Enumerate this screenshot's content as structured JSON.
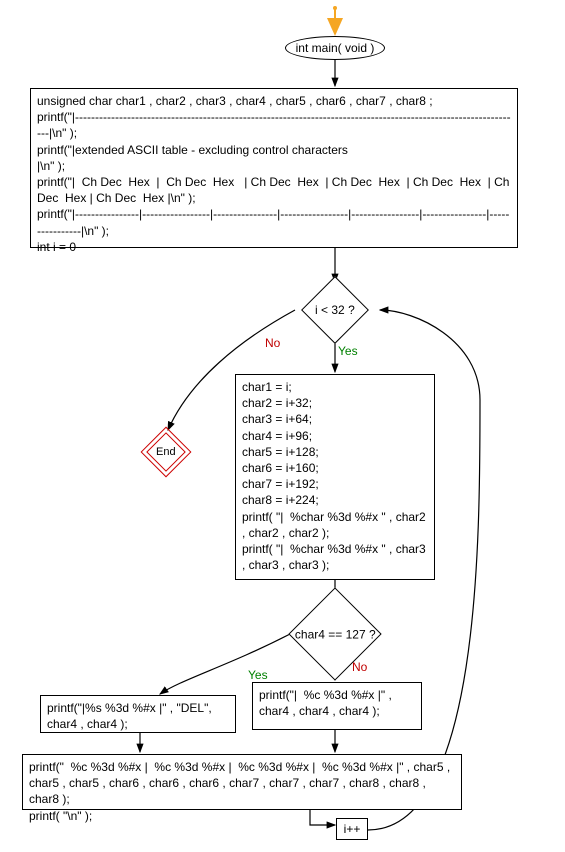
{
  "chart_data": {
    "type": "flowchart",
    "title": "",
    "nodes": [
      {
        "id": "start",
        "kind": "start-marker",
        "label": ""
      },
      {
        "id": "main",
        "kind": "terminator",
        "label": "int main( void )"
      },
      {
        "id": "init",
        "kind": "process",
        "label": "unsigned char char1 , char2 , char3 , char4 , char5 , char6 , char7 , char8 ;\nprintf(\"|----------------------------------------------------------------------------------------------------------------|\\n\" );\nprintf(\"|extended ASCII table - excluding control characters                                                 |\\n\" );\nprintf(\"|  Ch Dec  Hex  |  Ch Dec  Hex   | Ch Dec  Hex  | Ch Dec  Hex  | Ch Dec  Hex  | Ch Dec  Hex | Ch Dec  Hex |\\n\" );\nprintf(\"|----------------|-----------------|----------------|-----------------|-----------------|----------------|----------------|\\n\" );\nint i = 0"
      },
      {
        "id": "cond1",
        "kind": "decision",
        "label": "i < 32 ?"
      },
      {
        "id": "end",
        "kind": "end",
        "label": "End"
      },
      {
        "id": "assign",
        "kind": "process",
        "label": "char1 = i;\nchar2 = i+32;\nchar3 = i+64;\nchar4 = i+96;\nchar5 = i+128;\nchar6 = i+160;\nchar7 = i+192;\nchar8 = i+224;\nprintf( \"|  %char %3d %#x \" , char2 , char2 , char2 );\nprintf( \"|  %char %3d %#x \" , char3 , char3 , char3 );"
      },
      {
        "id": "cond2",
        "kind": "decision",
        "label": "char4 == 127 ?"
      },
      {
        "id": "yesbranch",
        "kind": "process",
        "label": "printf(\"|%s %3d %#x |\" , \"DEL\", char4 , char4 );"
      },
      {
        "id": "nobranch",
        "kind": "process",
        "label": "printf(\"|  %c %3d %#x |\" , char4 , char4 , char4 );"
      },
      {
        "id": "tail",
        "kind": "process",
        "label": "printf(\"  %c %3d %#x |  %c %3d %#x |  %c %3d %#x |  %c %3d %#x |\" , char5 , char5 , char5 , char6 , char6 , char6 , char7 , char7 , char7 , char8 , char8 , char8 );\nprintf( \"\\n\" );"
      },
      {
        "id": "inc",
        "kind": "process",
        "label": "i++"
      }
    ],
    "edges": [
      {
        "from": "start",
        "to": "main",
        "label": ""
      },
      {
        "from": "main",
        "to": "init",
        "label": ""
      },
      {
        "from": "init",
        "to": "cond1",
        "label": ""
      },
      {
        "from": "cond1",
        "to": "end",
        "label": "No"
      },
      {
        "from": "cond1",
        "to": "assign",
        "label": "Yes"
      },
      {
        "from": "assign",
        "to": "cond2",
        "label": ""
      },
      {
        "from": "cond2",
        "to": "yesbranch",
        "label": "Yes"
      },
      {
        "from": "cond2",
        "to": "nobranch",
        "label": "No"
      },
      {
        "from": "yesbranch",
        "to": "tail",
        "label": ""
      },
      {
        "from": "nobranch",
        "to": "tail",
        "label": ""
      },
      {
        "from": "tail",
        "to": "inc",
        "label": ""
      },
      {
        "from": "inc",
        "to": "cond1",
        "label": ""
      }
    ]
  },
  "labels": {
    "main": "int main( void )",
    "init": "unsigned char char1 , char2 , char3 , char4 , char5 , char6 , char7 , char8 ;\nprintf(\"|----------------------------------------------------------------------------------------------------------------|\\n\" );\nprintf(\"|extended ASCII table - excluding control characters                                                 |\\n\" );\nprintf(\"|  Ch Dec  Hex  |  Ch Dec  Hex   | Ch Dec  Hex  | Ch Dec  Hex  | Ch Dec  Hex  | Ch Dec  Hex | Ch Dec  Hex |\\n\" );\nprintf(\"|----------------|-----------------|----------------|-----------------|-----------------|----------------|----------------|\\n\" );\nint i = 0",
    "cond1": "i < 32 ?",
    "end": "End",
    "assign": "char1 = i;\nchar2 = i+32;\nchar3 = i+64;\nchar4 = i+96;\nchar5 = i+128;\nchar6 = i+160;\nchar7 = i+192;\nchar8 = i+224;\nprintf( \"|  %char %3d %#x \" , char2 , char2 , char2 );\nprintf( \"|  %char %3d %#x \" , char3 , char3 , char3 );",
    "cond2": "char4 == 127 ?",
    "yesbranch": "printf(\"|%s %3d %#x |\" , \"DEL\", char4 , char4 );",
    "nobranch": "printf(\"|  %c %3d %#x |\" , char4 , char4 , char4 );",
    "tail": "printf(\"  %c %3d %#x |  %c %3d %#x |  %c %3d %#x |  %c %3d %#x |\" , char5 , char5 , char5 , char6 , char6 , char6 , char7 , char7 , char7 , char8 , char8 , char8 );\nprintf( \"\\n\" );",
    "inc": "i++",
    "yes": "Yes",
    "no": "No"
  }
}
